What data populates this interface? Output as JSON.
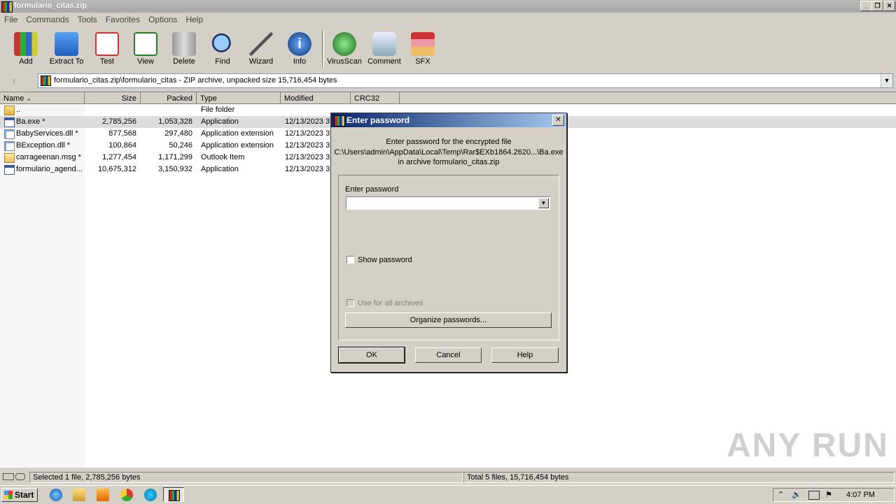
{
  "window": {
    "title": "formulario_citas.zip"
  },
  "menu": [
    "File",
    "Commands",
    "Tools",
    "Favorites",
    "Options",
    "Help"
  ],
  "toolbar": {
    "buttons": [
      "Add",
      "Extract To",
      "Test",
      "View",
      "Delete",
      "Find",
      "Wizard",
      "Info",
      "VirusScan",
      "Comment",
      "SFX"
    ]
  },
  "address": {
    "path": "formulario_citas.zip\\formulario_citas - ZIP archive, unpacked size 15,716,454 bytes"
  },
  "columns": [
    "Name",
    "Size",
    "Packed",
    "Type",
    "Modified",
    "CRC32"
  ],
  "files": [
    {
      "name": "..",
      "size": "",
      "packed": "",
      "type": "File folder",
      "modified": "",
      "icon": "folder-icon"
    },
    {
      "name": "Ba.exe *",
      "size": "2,785,256",
      "packed": "1,053,328",
      "type": "Application",
      "modified": "12/13/2023 3",
      "icon": "exe-icon"
    },
    {
      "name": "BabyServices.dll *",
      "size": "877,568",
      "packed": "297,480",
      "type": "Application extension",
      "modified": "12/13/2023 3",
      "icon": "dll-icon"
    },
    {
      "name": "BException.dll *",
      "size": "100,864",
      "packed": "50,246",
      "type": "Application extension",
      "modified": "12/13/2023 3",
      "icon": "dll-icon"
    },
    {
      "name": "carrageenan.msg *",
      "size": "1,277,454",
      "packed": "1,171,299",
      "type": "Outlook Item",
      "modified": "12/13/2023 3",
      "icon": "msg-icon"
    },
    {
      "name": "formulario_agend...",
      "size": "10,675,312",
      "packed": "3,150,932",
      "type": "Application",
      "modified": "12/13/2023 3",
      "icon": "exe-icon"
    }
  ],
  "status": {
    "left": "Selected 1 file, 2,785,256 bytes",
    "right": "Total 5 files, 15,716,454 bytes"
  },
  "taskbar": {
    "start": "Start",
    "clock": "4:07 PM"
  },
  "dialog": {
    "title": "Enter password",
    "line1": "Enter password for the encrypted file",
    "line2": "C:\\Users\\admin\\AppData\\Local\\Temp\\Rar$EXb1864.2620...\\Ba.exe",
    "line3": "in archive formulario_citas.zip",
    "password_label": "Enter password",
    "password_value": "",
    "show_password": "Show password",
    "use_all": "Use for all archives",
    "organize": "Organize passwords...",
    "ok": "OK",
    "cancel": "Cancel",
    "help": "Help"
  },
  "watermark": "ANY RUN"
}
